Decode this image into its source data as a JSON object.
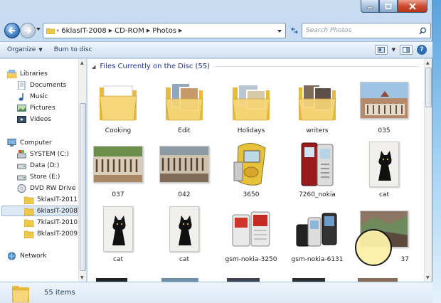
{
  "window": {
    "breadcrumb": [
      "6klasIT-2008",
      "CD-ROM",
      "Photos"
    ],
    "breadcrumb_prefix": "«",
    "search_placeholder": "Search Photos"
  },
  "toolbar": {
    "organize_label": "Organize",
    "burn_label": "Burn to disc"
  },
  "navigation": {
    "libraries_label": "Libraries",
    "library_items": [
      "Documents",
      "Music",
      "Pictures",
      "Videos"
    ],
    "computer_label": "Computer",
    "drives": [
      "SYSTEM (C:)",
      "Data (D:)",
      "Store (E:)",
      "DVD RW Drive (G"
    ],
    "folders": [
      "5klasIT-2011",
      "6klasIT-2008",
      "7klasIT-2010",
      "8klasIT-2009"
    ],
    "selected_folder": "6klasIT-2008",
    "network_label": "Network"
  },
  "content": {
    "group_header": "Files Currently on the Disc (55)",
    "items": [
      {
        "name": "Cooking",
        "kind": "folder"
      },
      {
        "name": "Edit",
        "kind": "folder"
      },
      {
        "name": "Holidays",
        "kind": "folder"
      },
      {
        "name": "writers",
        "kind": "folder"
      },
      {
        "name": "035",
        "kind": "photo-monastery"
      },
      {
        "name": "037",
        "kind": "photo-monastery"
      },
      {
        "name": "042",
        "kind": "photo-monastery"
      },
      {
        "name": "3650",
        "kind": "photo-phone-yellow"
      },
      {
        "name": "7260_nokia",
        "kind": "photo-phone-red"
      },
      {
        "name": "cat",
        "kind": "photo-cat"
      },
      {
        "name": "cat",
        "kind": "photo-cat"
      },
      {
        "name": "cat",
        "kind": "photo-cat"
      },
      {
        "name": "gsm-nokia-3250",
        "kind": "photo-phone-pair"
      },
      {
        "name": "gsm-nokia-6131",
        "kind": "photo-phone-flip"
      },
      {
        "name": "37",
        "kind": "photo-landscape"
      }
    ]
  },
  "status": {
    "item_count": "55 items"
  },
  "colors": {
    "accent": "#1e3287",
    "selection": "#dde8f5",
    "close_button": "#cf4c30"
  }
}
